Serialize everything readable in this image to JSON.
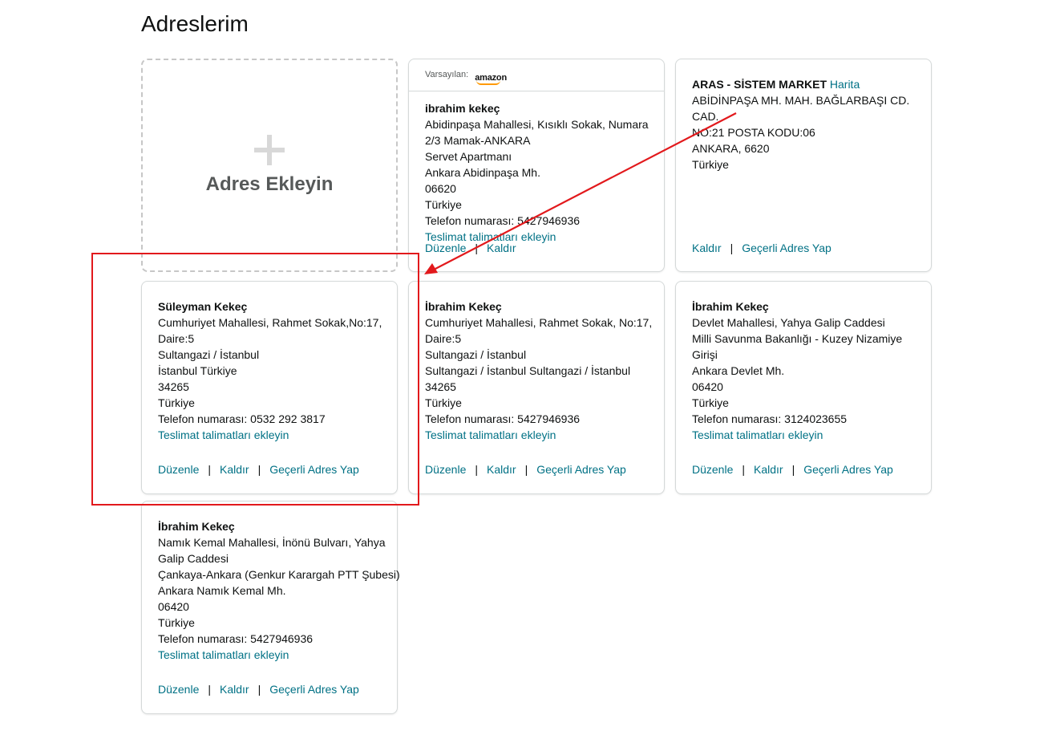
{
  "page": {
    "title": "Adreslerim"
  },
  "add_card": {
    "label": "Adres Ekleyin"
  },
  "default_card": {
    "header_label": "Varsayılan:",
    "logo_text": "amazon",
    "name": "ibrahim kekeç",
    "lines": [
      "Abidinpaşa Mahallesi, Kısıklı Sokak, Numara",
      "2/3 Mamak-ANKARA",
      "Servet Apartmanı",
      "Ankara Abidinpaşa Mh.",
      "06620",
      "Türkiye",
      "Telefon numarası: 5427946936"
    ],
    "instructions_link": "Teslimat talimatları ekleyin",
    "edit": "Düzenle",
    "remove": "Kaldır"
  },
  "aras_card": {
    "name": "ARAS - SİSTEM MARKET",
    "map_link": "Harita",
    "lines": [
      "ABİDİNPAŞA MH. MAH. BAĞLARBAŞI CD. CAD.",
      "NO:21 POSTA KODU:06",
      "ANKARA, 6620",
      "Türkiye"
    ],
    "remove": "Kaldır",
    "make_default": "Geçerli Adres Yap"
  },
  "cards": [
    {
      "name": "Süleyman Kekeç",
      "lines": [
        "Cumhuriyet Mahallesi, Rahmet Sokak,No:17,",
        "Daire:5",
        "Sultangazi / İstanbul",
        "İstanbul Türkiye",
        "34265",
        "Türkiye",
        "Telefon numarası: 0532 292 3817"
      ],
      "instructions_link": "Teslimat talimatları ekleyin",
      "edit": "Düzenle",
      "remove": "Kaldır",
      "make_default": "Geçerli Adres Yap"
    },
    {
      "name": "İbrahim Kekeç",
      "lines": [
        "Cumhuriyet Mahallesi, Rahmet Sokak, No:17,",
        "Daire:5",
        "Sultangazi / İstanbul",
        "Sultangazi / İstanbul Sultangazi / İstanbul",
        "34265",
        "Türkiye",
        "Telefon numarası: 5427946936"
      ],
      "instructions_link": "Teslimat talimatları ekleyin",
      "edit": "Düzenle",
      "remove": "Kaldır",
      "make_default": "Geçerli Adres Yap"
    },
    {
      "name": "İbrahim Kekeç",
      "lines": [
        "Devlet Mahallesi, Yahya Galip Caddesi",
        "Milli Savunma Bakanlığı - Kuzey Nizamiye",
        "Girişi",
        "Ankara Devlet Mh.",
        "06420",
        "Türkiye",
        "Telefon numarası: 3124023655"
      ],
      "instructions_link": "Teslimat talimatları ekleyin",
      "edit": "Düzenle",
      "remove": "Kaldır",
      "make_default": "Geçerli Adres Yap"
    },
    {
      "name": "İbrahim Kekeç",
      "lines": [
        "Namık Kemal Mahallesi, İnönü Bulvarı, Yahya",
        "Galip Caddesi",
        "Çankaya-Ankara (Genkur Karargah PTT Şubesi)",
        "Ankara Namık Kemal Mh.",
        "06420",
        "Türkiye",
        "Telefon numarası: 5427946936"
      ],
      "instructions_link": "Teslimat talimatları ekleyin",
      "edit": "Düzenle",
      "remove": "Kaldır",
      "make_default": "Geçerli Adres Yap"
    }
  ],
  "colors": {
    "link": "#007185",
    "annotation": "#e2191c",
    "border": "#d5d9d9"
  }
}
